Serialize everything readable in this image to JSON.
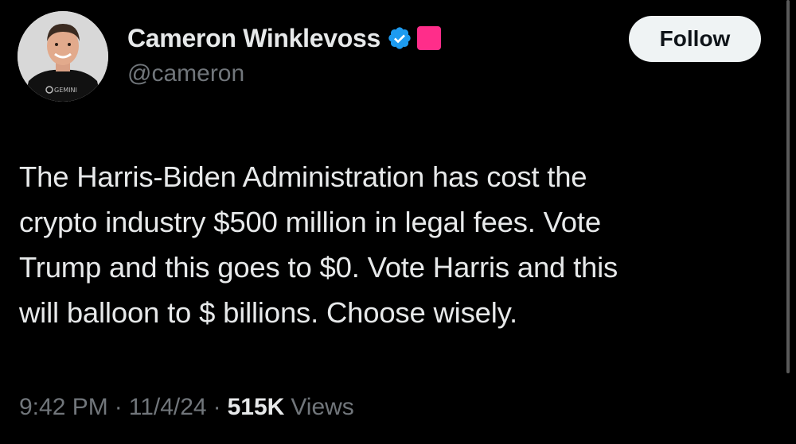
{
  "author": {
    "display_name": "Cameron Winklevoss",
    "handle": "@cameron",
    "avatar_shirt_text": "GEMINI",
    "verified_color": "#1d9bf0",
    "affiliate_badge_color": "#ff2d8a"
  },
  "follow_button": {
    "label": "Follow"
  },
  "tweet": {
    "lines": [
      "The Harris-Biden Administration has cost the",
      "crypto industry $500 million in legal fees. Vote",
      "Trump and this goes to $0. Vote Harris and this",
      "will balloon to $ billions. Choose wisely."
    ]
  },
  "meta": {
    "time": "9:42 PM",
    "separator": "·",
    "date": "11/4/24",
    "views_count": "515K",
    "views_label": "Views"
  },
  "colors": {
    "background": "#000000",
    "text_primary": "#e7e9ea",
    "text_secondary": "#71767b"
  }
}
